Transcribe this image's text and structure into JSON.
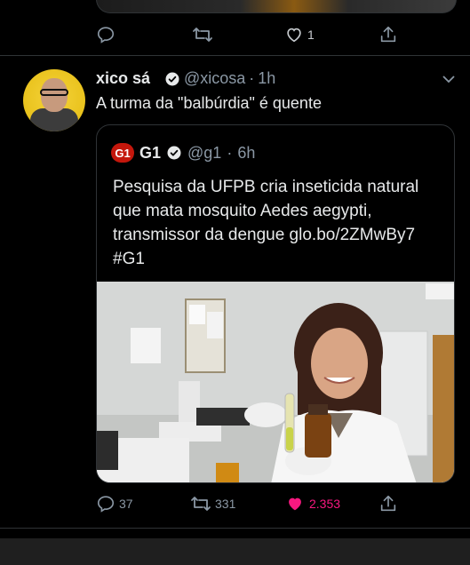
{
  "prev_tweet": {
    "reply_count": "",
    "retweet_count": "",
    "like_count": "1"
  },
  "tweet": {
    "author_name": "xico sá",
    "handle": "@xicosa",
    "separator": "·",
    "time": "1h",
    "text": "A turma da \"balbúrdia\" é quente",
    "quoted": {
      "logo_text": "G1",
      "author_name": "G1",
      "handle": "@g1",
      "separator": "·",
      "time": "6h",
      "text": "Pesquisa da UFPB cria inseticida natural que mata mosquito Aedes aegypti, transmissor da dengue glo.bo/2ZMwBy7 #G1"
    },
    "reply_count": "37",
    "retweet_count": "331",
    "like_count": "2.353"
  },
  "colors": {
    "background": "#000000",
    "text": "#e7e9ea",
    "secondary": "#8b98a5",
    "like_active": "#f91880",
    "g1_brand": "#c4170c"
  },
  "icons": [
    "reply-icon",
    "retweet-icon",
    "like-icon",
    "share-icon",
    "verified-icon",
    "chevron-down-icon"
  ]
}
